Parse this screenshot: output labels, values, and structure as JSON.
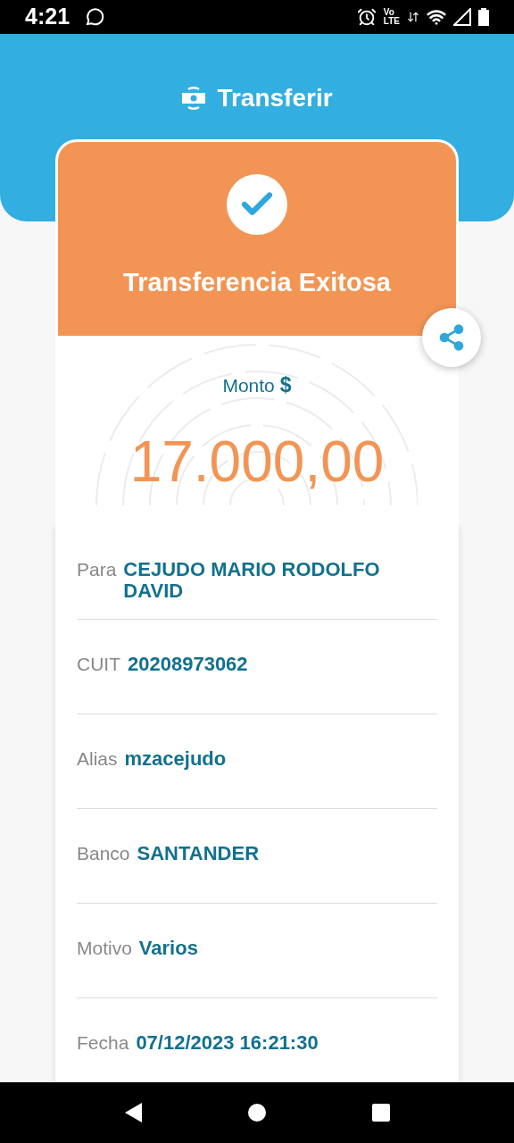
{
  "status_bar": {
    "time": "4:21",
    "network_top": "Vo",
    "network_bottom": "LTE"
  },
  "header": {
    "title": "Transferir"
  },
  "result": {
    "title": "Transferencia Exitosa"
  },
  "amount": {
    "label": "Monto",
    "currency": "$",
    "value": "17.000,00"
  },
  "details": [
    {
      "label": "Para",
      "value": "CEJUDO MARIO RODOLFO DAVID"
    },
    {
      "label": "CUIT",
      "value": "20208973062"
    },
    {
      "label": "Alias",
      "value": "mzacejudo"
    },
    {
      "label": "Banco",
      "value": "SANTANDER"
    },
    {
      "label": "Motivo",
      "value": "Varios"
    },
    {
      "label": "Fecha",
      "value": "07/12/2023 16:21:30"
    }
  ]
}
